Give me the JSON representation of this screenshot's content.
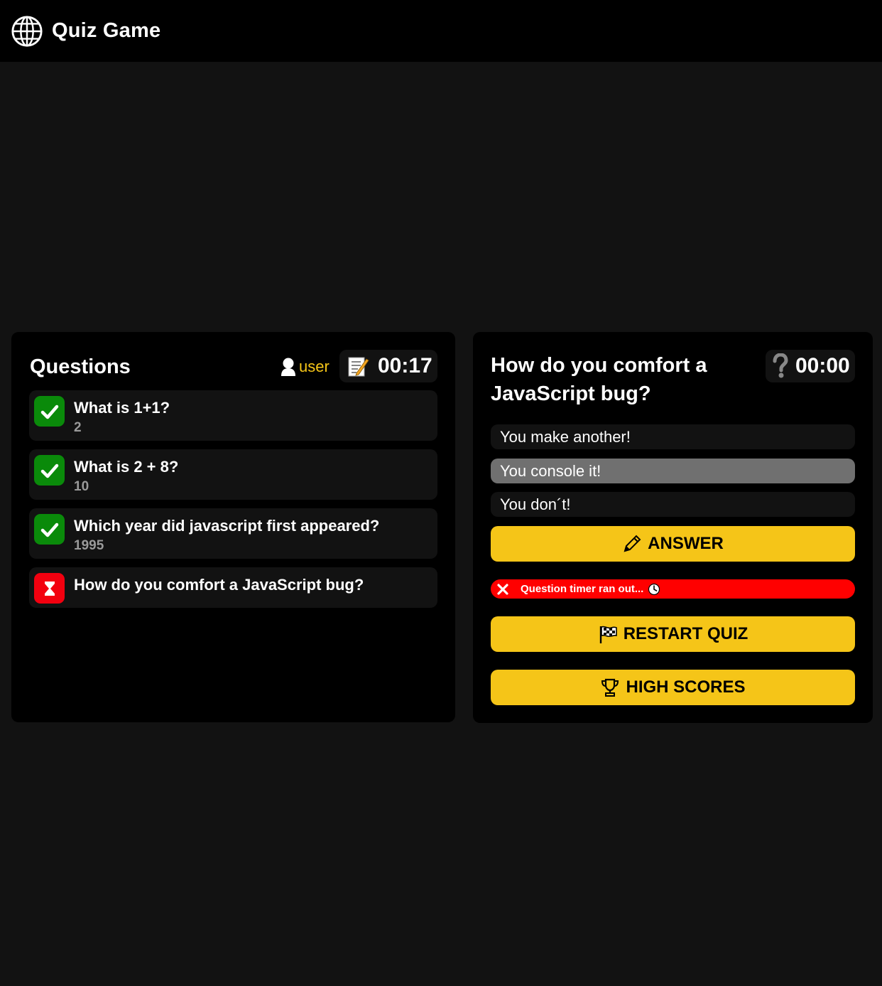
{
  "app": {
    "title": "Quiz Game"
  },
  "questions_panel": {
    "title": "Questions",
    "username": "user",
    "quiz_timer": "00:17",
    "items": [
      {
        "text": "What is 1+1?",
        "answer": "2",
        "status": "correct"
      },
      {
        "text": "What is 2 + 8?",
        "answer": "10",
        "status": "correct"
      },
      {
        "text": "Which year did javascript first appeared?",
        "answer": "1995",
        "status": "correct"
      },
      {
        "text": "How do you comfort a JavaScript bug?",
        "answer": "",
        "status": "timed-out"
      }
    ]
  },
  "question_panel": {
    "question": "How do you comfort a JavaScript bug?",
    "question_timer": "00:00",
    "options": [
      {
        "label": "You make another!",
        "selected": false
      },
      {
        "label": "You console it!",
        "selected": true
      },
      {
        "label": "You don´t!",
        "selected": false
      }
    ],
    "answer_button": "ANSWER",
    "alert_message": "Question timer ran out...",
    "restart_button": "RESTART QUIZ",
    "highscores_button": "HIGH SCORES"
  },
  "colors": {
    "accent_yellow": "#f5c518",
    "correct_green": "#0a8a0a",
    "timeout_red": "#f2000f",
    "alert_red": "#ff0000",
    "selected_gray": "#707070"
  }
}
